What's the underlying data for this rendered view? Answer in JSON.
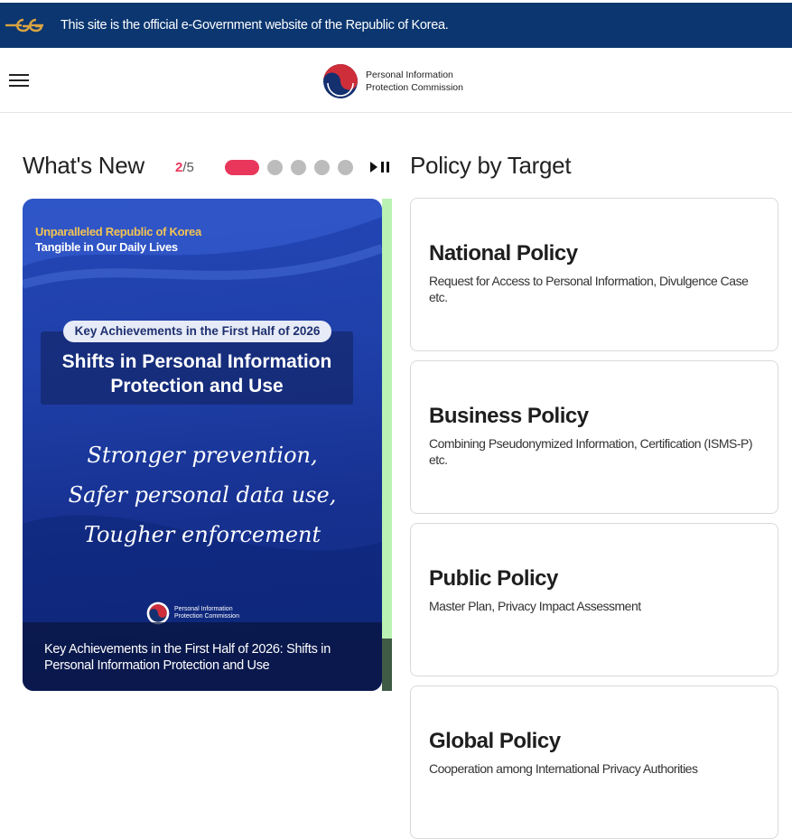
{
  "gov_banner": {
    "text": "This site is the official e-Government website of the Republic of Korea."
  },
  "header": {
    "logo_line1": "Personal Information",
    "logo_line2": "Protection Commission"
  },
  "whats_new": {
    "title": "What's New",
    "counter_current": "2",
    "counter_total": "5",
    "slide_count": 5,
    "active_index": 0,
    "card": {
      "tag1": "Unparalleled Republic of Korea",
      "tag2": "Tangible in Our Daily Lives",
      "pill": "Key Achievements in the First Half of 2026",
      "headline_line1": "Shifts in Personal Information",
      "headline_line2": "Protection and Use",
      "script_line1": "Stronger prevention,",
      "script_line2": "Safer personal data use,",
      "script_line3": "Tougher enforcement",
      "mini_logo_line1": "Personal Information",
      "mini_logo_line2": "Protection Commission",
      "caption": "Key Achievements in the First Half of 2026: Shifts in Personal Information Protection and Use"
    }
  },
  "policy_by_target": {
    "title": "Policy by Target",
    "items": [
      {
        "title": "National Policy",
        "desc": "Request for Access to Personal Information, Divulgence Case etc."
      },
      {
        "title": "Business Policy",
        "desc": "Combining Pseudonymized Information, Certification (ISMS-P) etc."
      },
      {
        "title": "Public Policy",
        "desc": "Master Plan, Privacy Impact Assessment"
      },
      {
        "title": "Global Policy",
        "desc": "Cooperation among International Privacy Authorities"
      }
    ]
  },
  "colors": {
    "banner_bg": "#0b3670",
    "accent": "#e8375b",
    "dot_inactive": "#bcbcbc",
    "card_blue": "#1f3fa8"
  },
  "icons": [
    "eg-logo-icon",
    "hamburger-menu-icon",
    "taegeuk-logo-icon",
    "play-pause-icon"
  ]
}
